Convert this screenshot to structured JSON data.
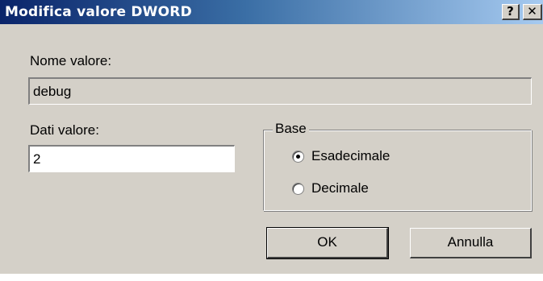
{
  "window": {
    "title": "Modifica valore DWORD",
    "help_label": "?",
    "close_label": "✕"
  },
  "value_name": {
    "label": "Nome valore:",
    "value": "debug"
  },
  "value_data": {
    "label": "Dati valore:",
    "value": "2"
  },
  "base": {
    "legend": "Base",
    "options": [
      {
        "label": "Esadecimale",
        "selected": true
      },
      {
        "label": "Decimale",
        "selected": false
      }
    ]
  },
  "buttons": {
    "ok_label": "OK",
    "cancel_label": "Annulla"
  },
  "colors": {
    "dialog_face": "#d4d0c8",
    "titlebar_start": "#0a246a",
    "titlebar_end": "#a6caf0"
  },
  "icons": {
    "help": "help-icon",
    "close": "close-icon"
  }
}
